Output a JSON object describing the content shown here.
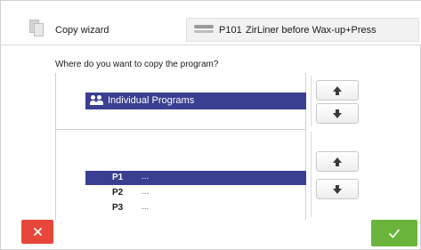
{
  "header": {
    "title": "Copy wizard",
    "program_code": "P101",
    "program_name": "ZirLiner before Wax-up+Press"
  },
  "question": "Where do you want to copy the program?",
  "source_list": {
    "selected_group": "Individual Programs"
  },
  "target_list": {
    "items": [
      {
        "id": "P1",
        "value": "...",
        "selected": true
      },
      {
        "id": "P2",
        "value": "...",
        "selected": false
      },
      {
        "id": "P3",
        "value": "...",
        "selected": false
      }
    ]
  },
  "icons": {
    "copy": "copy-icon",
    "group": "users-icon",
    "up": "arrow-up-icon",
    "down": "arrow-down-icon",
    "cancel": "close-icon",
    "confirm": "checkmark-icon"
  },
  "colors": {
    "selection": "#3a3f92",
    "cancel": "#e8463a",
    "confirm": "#6ab43c"
  }
}
